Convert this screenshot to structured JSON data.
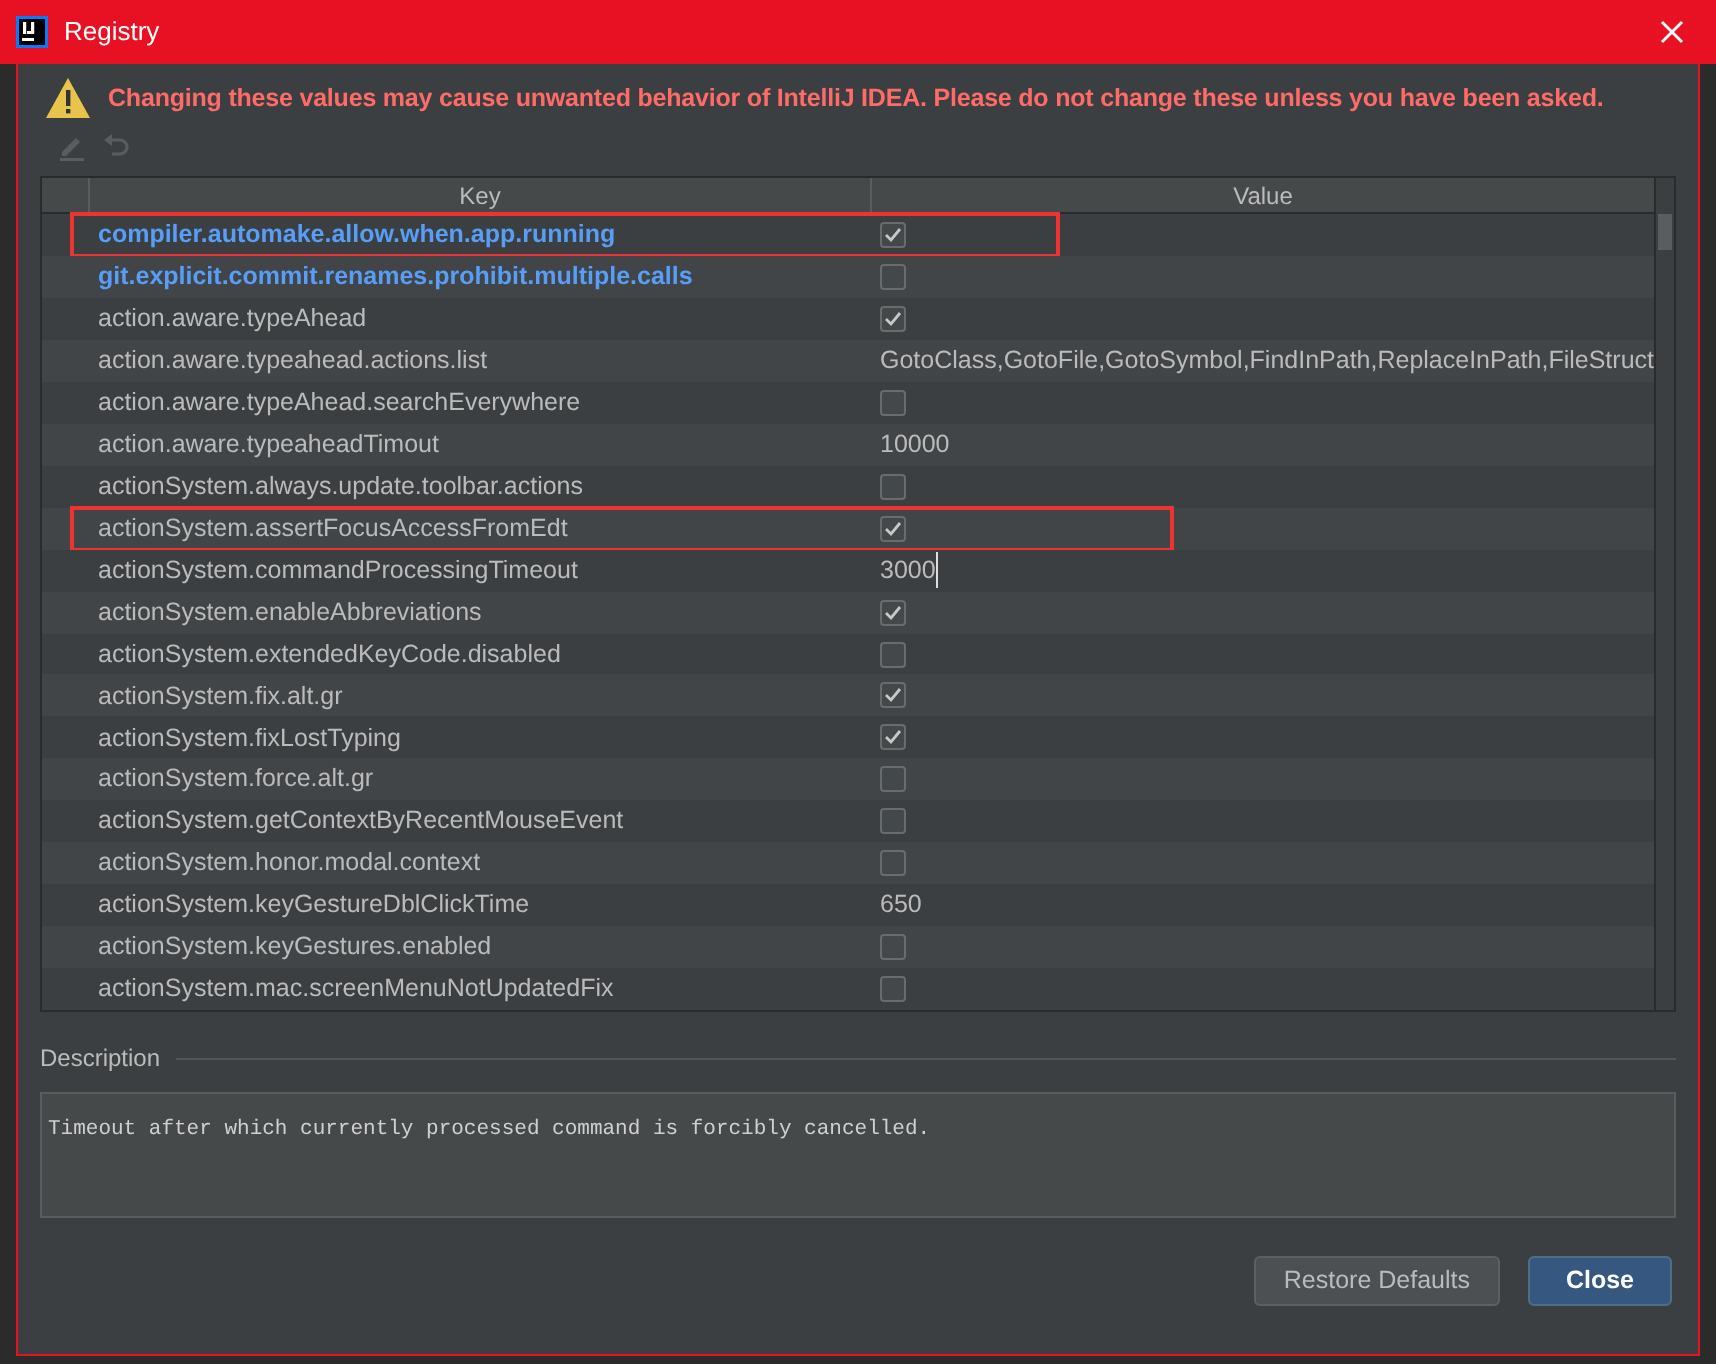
{
  "window": {
    "title": "Registry"
  },
  "warning": "Changing these values may cause unwanted behavior of IntelliJ IDEA. Please do not change these unless you have been asked.",
  "toolbar": [
    {
      "kind": "edit",
      "disabled": true
    },
    {
      "kind": "revert",
      "disabled": true
    }
  ],
  "table": {
    "columns": [
      "Key",
      "Value"
    ],
    "rows": [
      {
        "key": "compiler.automake.allow.when.app.running",
        "kind": "bool",
        "checked": true,
        "modified": true,
        "highlighted": true
      },
      {
        "key": "git.explicit.commit.renames.prohibit.multiple.calls",
        "kind": "bool",
        "checked": false,
        "modified": true,
        "highlighted": false
      },
      {
        "key": "action.aware.typeAhead",
        "kind": "bool",
        "checked": true,
        "modified": false,
        "highlighted": false
      },
      {
        "key": "action.aware.typeahead.actions.list",
        "kind": "text",
        "value": "GotoClass,GotoFile,GotoSymbol,FindInPath,ReplaceInPath,FileStruct",
        "modified": false,
        "highlighted": false
      },
      {
        "key": "action.aware.typeAhead.searchEverywhere",
        "kind": "bool",
        "checked": false,
        "modified": false,
        "highlighted": false
      },
      {
        "key": "action.aware.typeaheadTimout",
        "kind": "text",
        "value": "10000",
        "modified": false,
        "highlighted": false
      },
      {
        "key": "actionSystem.always.update.toolbar.actions",
        "kind": "bool",
        "checked": false,
        "modified": false,
        "highlighted": false
      },
      {
        "key": "actionSystem.assertFocusAccessFromEdt",
        "kind": "bool",
        "checked": true,
        "modified": false,
        "highlighted": true
      },
      {
        "key": "actionSystem.commandProcessingTimeout",
        "kind": "text",
        "value": "3000",
        "editing": true,
        "modified": false,
        "highlighted": false
      },
      {
        "key": "actionSystem.enableAbbreviations",
        "kind": "bool",
        "checked": true,
        "modified": false,
        "highlighted": false
      },
      {
        "key": "actionSystem.extendedKeyCode.disabled",
        "kind": "bool",
        "checked": false,
        "modified": false,
        "highlighted": false
      },
      {
        "key": "actionSystem.fix.alt.gr",
        "kind": "bool",
        "checked": true,
        "modified": false,
        "highlighted": false
      },
      {
        "key": "actionSystem.fixLostTyping",
        "kind": "bool",
        "checked": true,
        "modified": false,
        "highlighted": false
      },
      {
        "key": "actionSystem.force.alt.gr",
        "kind": "bool",
        "checked": false,
        "modified": false,
        "highlighted": false
      },
      {
        "key": "actionSystem.getContextByRecentMouseEvent",
        "kind": "bool",
        "checked": false,
        "modified": false,
        "highlighted": false
      },
      {
        "key": "actionSystem.honor.modal.context",
        "kind": "bool",
        "checked": false,
        "modified": false,
        "highlighted": false
      },
      {
        "key": "actionSystem.keyGestureDblClickTime",
        "kind": "text",
        "value": "650",
        "modified": false,
        "highlighted": false
      },
      {
        "key": "actionSystem.keyGestures.enabled",
        "kind": "bool",
        "checked": false,
        "modified": false,
        "highlighted": false
      },
      {
        "key": "actionSystem.mac.screenMenuNotUpdatedFix",
        "kind": "bool",
        "checked": false,
        "modified": false,
        "highlighted": false
      }
    ]
  },
  "description": {
    "label": "Description",
    "text": "Timeout after which currently processed command is forcibly cancelled."
  },
  "buttons": [
    {
      "label": "Restore Defaults",
      "kind": "secondary"
    },
    {
      "label": "Close",
      "kind": "primary"
    }
  ]
}
